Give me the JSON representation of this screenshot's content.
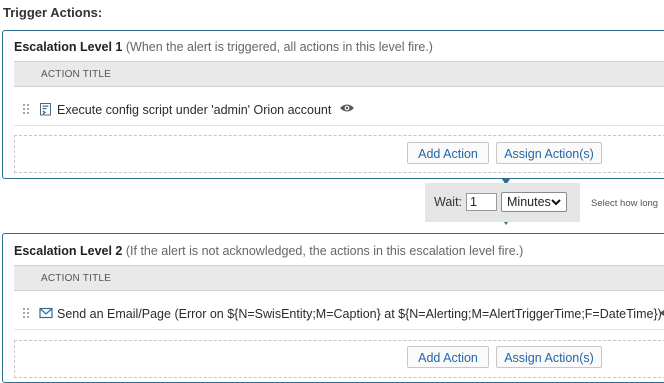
{
  "section_title": "Trigger Actions:",
  "levels": [
    {
      "title": "Escalation Level 1",
      "description": "(When the alert is triggered, all actions in this level fire.)",
      "column_header": "ACTION TITLE",
      "action": "Execute config script under 'admin' Orion account",
      "action_icon": "script-icon",
      "add_label": "Add Action",
      "assign_label": "Assign Action(s)"
    },
    {
      "title": "Escalation Level 2",
      "description": "(If the alert is not acknowledged, the actions in this escalation level fire.)",
      "column_header": "ACTION TITLE",
      "action": "Send an Email/Page (Error on ${N=SwisEntity;M=Caption} at ${N=Alerting;M=AlertTriggerTime;F=DateTime})",
      "action_icon": "email-icon",
      "add_label": "Add Action",
      "assign_label": "Assign Action(s)"
    }
  ],
  "wait": {
    "label": "Wait:",
    "value": "1",
    "unit": "Minutes",
    "hint": "Select how long"
  },
  "colors": {
    "border": "#2d6f8f",
    "link": "#2266aa",
    "panel": "#e5e5e5"
  }
}
